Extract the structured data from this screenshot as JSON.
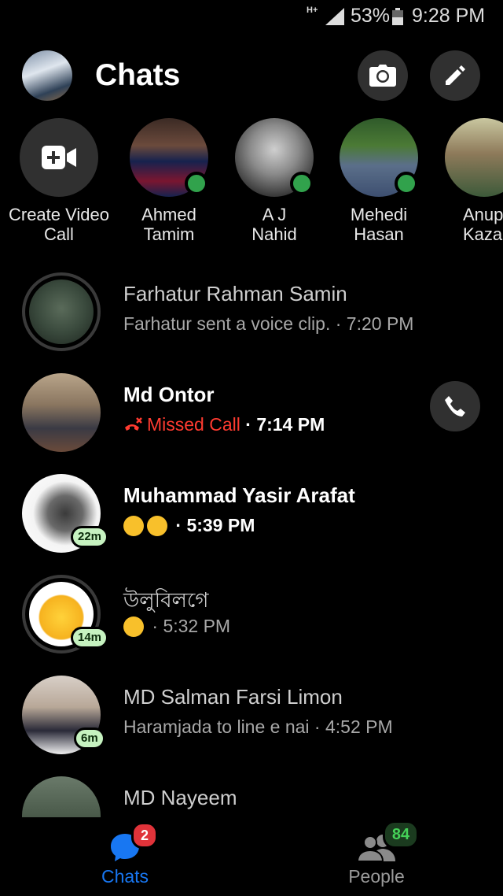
{
  "status_bar": {
    "network": "H+",
    "battery_percent": "53%",
    "time": "9:28 PM"
  },
  "header": {
    "title": "Chats",
    "camera_icon": "camera-icon",
    "compose_icon": "pencil-icon"
  },
  "stories": [
    {
      "name": "Create Video Call",
      "line1": "Create Video",
      "line2": "Call",
      "icon": "video-plus-icon",
      "online": false
    },
    {
      "name": "Ahmed Tamim",
      "line1": "Ahmed",
      "line2": "Tamim",
      "online": true
    },
    {
      "name": "A J Nahid",
      "line1": "A J",
      "line2": "Nahid",
      "online": true
    },
    {
      "name": "Mehedi Hasan",
      "line1": "Mehedi",
      "line2": "Hasan",
      "online": true
    },
    {
      "name": "Anup Kaza",
      "line1": "Anup",
      "line2": "Kaza",
      "online": false
    }
  ],
  "chats": [
    {
      "name": "Farhatur Rahman Samin",
      "snippet": "Farhatur sent a voice clip.",
      "time": "· 7:20 PM",
      "unread": false,
      "ring": true
    },
    {
      "name": "Md Ontor",
      "snippet": "Missed Call",
      "time": "· 7:14 PM",
      "unread": true,
      "missed_call": true
    },
    {
      "name": "Muhammad Yasir Arafat",
      "time": "· 5:39 PM",
      "unread": true,
      "active_badge": "22m",
      "emoji": [
        "rolling-on-floor-laughing-emoji",
        "rolling-on-floor-laughing-emoji"
      ]
    },
    {
      "name": "উলুবিলগে",
      "time": "· 5:32 PM",
      "unread": false,
      "active_badge": "14m",
      "ring": true,
      "emoji": [
        "expressionless-face-emoji"
      ]
    },
    {
      "name": "MD Salman Farsi Limon",
      "snippet": "Haramjada to line e nai",
      "time": "· 4:52 PM",
      "unread": false,
      "active_badge": "6m"
    },
    {
      "name": "MD Nayeem",
      "unread": false
    }
  ],
  "bottom_nav": {
    "chats": {
      "label": "Chats",
      "badge": "2",
      "active": true
    },
    "people": {
      "label": "People",
      "badge": "84",
      "active": false
    }
  },
  "colors": {
    "accent": "#1877f2",
    "online": "#31a24c",
    "missed": "#ff3b30",
    "badge_red": "#e0333a"
  }
}
